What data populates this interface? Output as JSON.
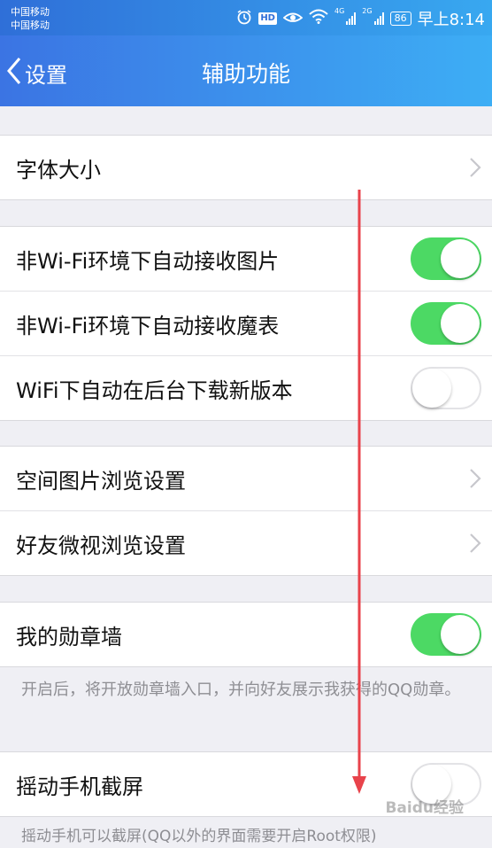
{
  "statusbar": {
    "carrier1": "中国移动",
    "carrier2": "中国移动",
    "hd": "HD",
    "net1": "4G",
    "net2": "2G",
    "battery": "86",
    "time": "早上8:14"
  },
  "navbar": {
    "back_label": "设置",
    "title": "辅助功能"
  },
  "groups": {
    "g1": {
      "font_size": "字体大小"
    },
    "g2": {
      "auto_recv_image": {
        "label": "非Wi-Fi环境下自动接收图片",
        "checked": true
      },
      "auto_recv_magic": {
        "label": "非Wi-Fi环境下自动接收魔表",
        "checked": true
      },
      "wifi_bg_download": {
        "label": "WiFi下自动在后台下载新版本",
        "checked": false
      }
    },
    "g3": {
      "qzone_images": "空间图片浏览设置",
      "friend_weishi": "好友微视浏览设置"
    },
    "g4": {
      "medal_wall": {
        "label": "我的勋章墙",
        "checked": true
      },
      "note": "开启后，将开放勋章墙入口，并向好友展示我获得的QQ勋章。"
    },
    "g5": {
      "shake_screenshot": {
        "label": "摇动手机截屏",
        "checked": false
      },
      "note": "摇动手机可以截屏(QQ以外的界面需要开启Root权限)"
    }
  },
  "colors": {
    "toggle_on": "#4cd964",
    "nav_gradient_start": "#3b74e3",
    "nav_gradient_end": "#3daef5",
    "arrow": "#e8434b"
  },
  "watermark": "Baidu经验"
}
